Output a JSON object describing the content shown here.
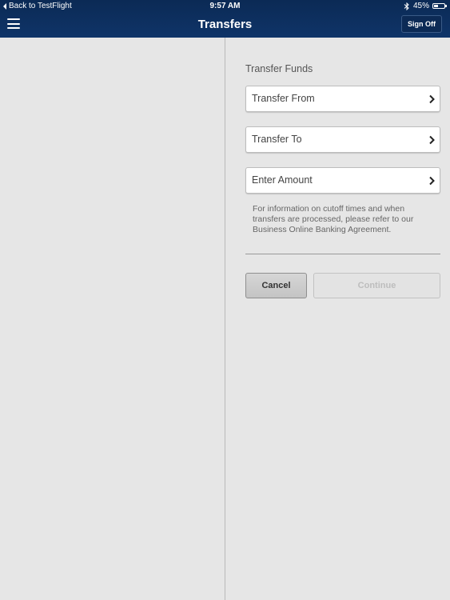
{
  "status_bar": {
    "back_label": "Back to TestFlight",
    "time": "9:57 AM",
    "battery": "45%",
    "battery_level": 0.45
  },
  "header": {
    "title": "Transfers",
    "sign_off_label": "Sign Off",
    "menu_icon": "hamburger-icon"
  },
  "form": {
    "section_title": "Transfer Funds",
    "fields": [
      {
        "label": "Transfer From",
        "icon": "chevron-right-icon"
      },
      {
        "label": "Transfer To",
        "icon": "chevron-right-icon"
      },
      {
        "label": "Enter Amount",
        "icon": "chevron-right-icon"
      }
    ],
    "info_text": "For information on cutoff times and when transfers are processed, please refer to our Business Online Banking Agreement.",
    "cancel_label": "Cancel",
    "continue_label": "Continue"
  },
  "colors": {
    "header_bg": "#0f3468",
    "page_bg": "#e6e6e6"
  }
}
